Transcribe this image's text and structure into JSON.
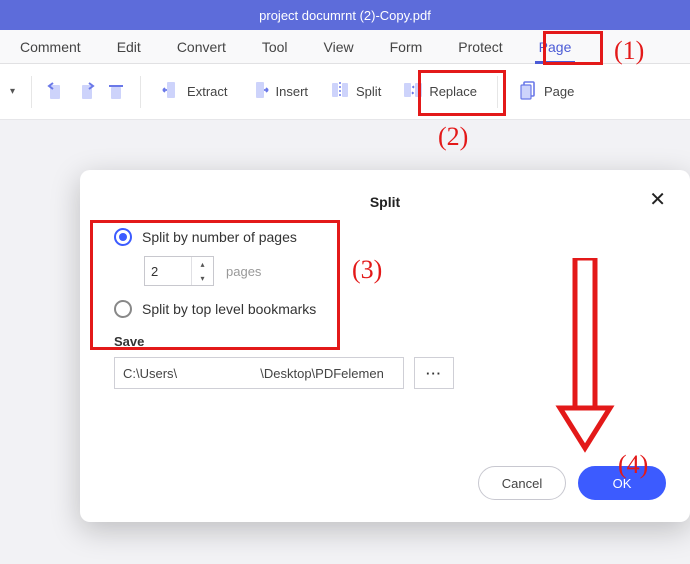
{
  "title": "project documrnt (2)-Copy.pdf",
  "menu": {
    "items": [
      {
        "label": "Comment"
      },
      {
        "label": "Edit"
      },
      {
        "label": "Convert"
      },
      {
        "label": "Tool"
      },
      {
        "label": "View"
      },
      {
        "label": "Form"
      },
      {
        "label": "Protect"
      },
      {
        "label": "Page"
      }
    ],
    "active_index": 7
  },
  "toolbar": {
    "extract": "Extract",
    "insert": "Insert",
    "split": "Split",
    "replace": "Replace",
    "page": "Page"
  },
  "dialog": {
    "title": "Split",
    "opt_by_pages": "Split by number of pages",
    "page_count": "2",
    "pages_word": "pages",
    "opt_by_bookmarks": "Split by top level bookmarks",
    "save_label": "Save",
    "save_path": "C:\\Users\\                       \\Desktop\\PDFelemen",
    "browse": "···",
    "cancel": "Cancel",
    "ok": "OK"
  },
  "annotations": {
    "a1": "(1)",
    "a2": "(2)",
    "a3": "(3)",
    "a4": "(4)"
  },
  "icons": {
    "purple": "#6a78e8"
  }
}
